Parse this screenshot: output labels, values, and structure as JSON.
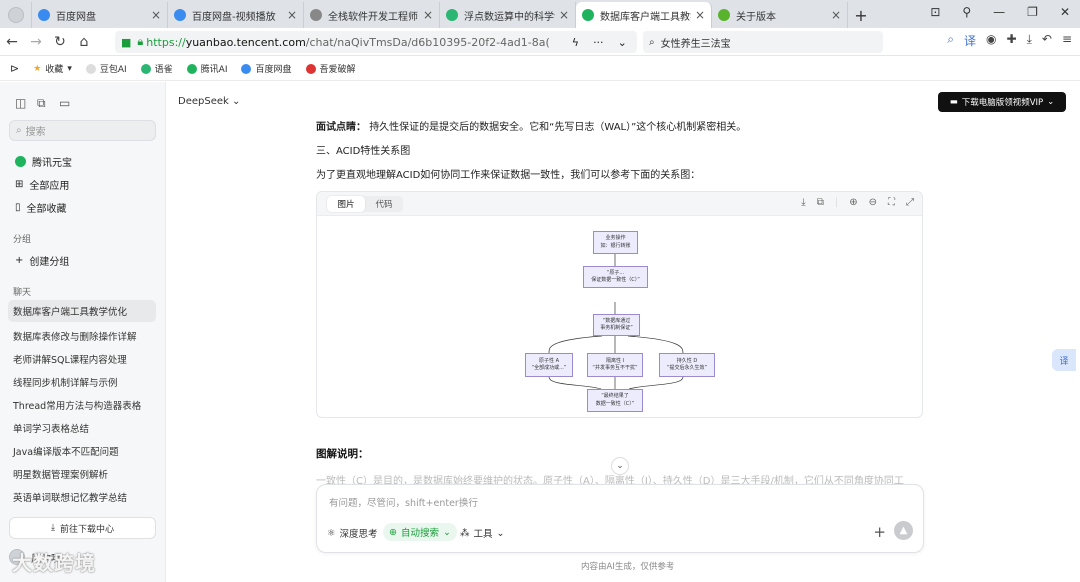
{
  "tabs": [
    {
      "label": "百度网盘",
      "color": "#3a8bf0"
    },
    {
      "label": "百度网盘-视频播放",
      "color": "#3a8bf0"
    },
    {
      "label": "全栈软件开发工程师 -",
      "color": "#888"
    },
    {
      "label": "浮点数运算中的科学计",
      "color": "#2bb673"
    },
    {
      "label": "数据库客户端工具教学",
      "color": "#1fb35e"
    },
    {
      "label": "关于版本",
      "color": "#59b32d"
    }
  ],
  "url": {
    "scheme": "https://",
    "host": "yuanbao.tencent.com",
    "path": "/chat/naQivTmsDa/d6b10395-20f2-4ad1-8a("
  },
  "search_box": "女性养生三法宝",
  "bookmarks": [
    "收藏",
    "豆包AI",
    "语雀",
    "腾讯AI",
    "百度网盘",
    "吾爱破解"
  ],
  "sidebar": {
    "search_placeholder": "搜索",
    "nav": [
      "腾讯元宝",
      "全部应用",
      "全部收藏"
    ],
    "group_label": "分组",
    "create_group": "创建分组",
    "chat_label": "聊天",
    "chats": [
      "数据库客户端工具教学优化",
      "数据库表修改与删除操作详解",
      "老师讲解SQL课程内容处理",
      "线程同步机制详解与示例",
      "Thread常用方法与构造器表格",
      "单词学习表格总结",
      "Java编译版本不匹配问题",
      "明星数据管理案例解析",
      "英语单词联想记忆教学总结"
    ],
    "download": "前往下载中心",
    "username": "风吹哦",
    "watermark": "大数跨境"
  },
  "header": {
    "model": "DeepSeek",
    "vip": "下载电脑版领视频VIP"
  },
  "content": {
    "line1_bold": "面试点睛：",
    "line1": "持久性保证的是提交后的数据安全。它和“先写日志（WAL）”这个核心机制紧密相关。",
    "heading": "三、ACID特性关系图",
    "intro": "为了更直观地理解ACID如何协同工作来保证数据一致性，我们可以参考下面的关系图：",
    "tab_image": "图片",
    "tab_code": "代码",
    "nodes": [
      "业务操作\n如：银行转账",
      "“原子...\n保证数据一致性（C）”",
      "“数据库通过\n事务机制保证”",
      "原子性 A\n“全部成功或...”",
      "隔离性 I\n“并发事务互不干扰”",
      "持久性 D\n“提交后永久生效”",
      "“最终结果了\n数据一致性（C）”"
    ],
    "explain_heading": "图解说明：",
    "faded": "一致性（C）是目的，是数据库始终要维护的状态。原子性（A）、隔离性（I）、持久性（D）是三大手段/机制，它们从不同角度协同工"
  },
  "composer": {
    "placeholder": "有问题，尽管问，shift+enter换行",
    "deep_think": "深度思考",
    "auto_search": "自动搜索",
    "tools": "工具"
  },
  "footer": "内容由AI生成，仅供参考",
  "translate": "译"
}
